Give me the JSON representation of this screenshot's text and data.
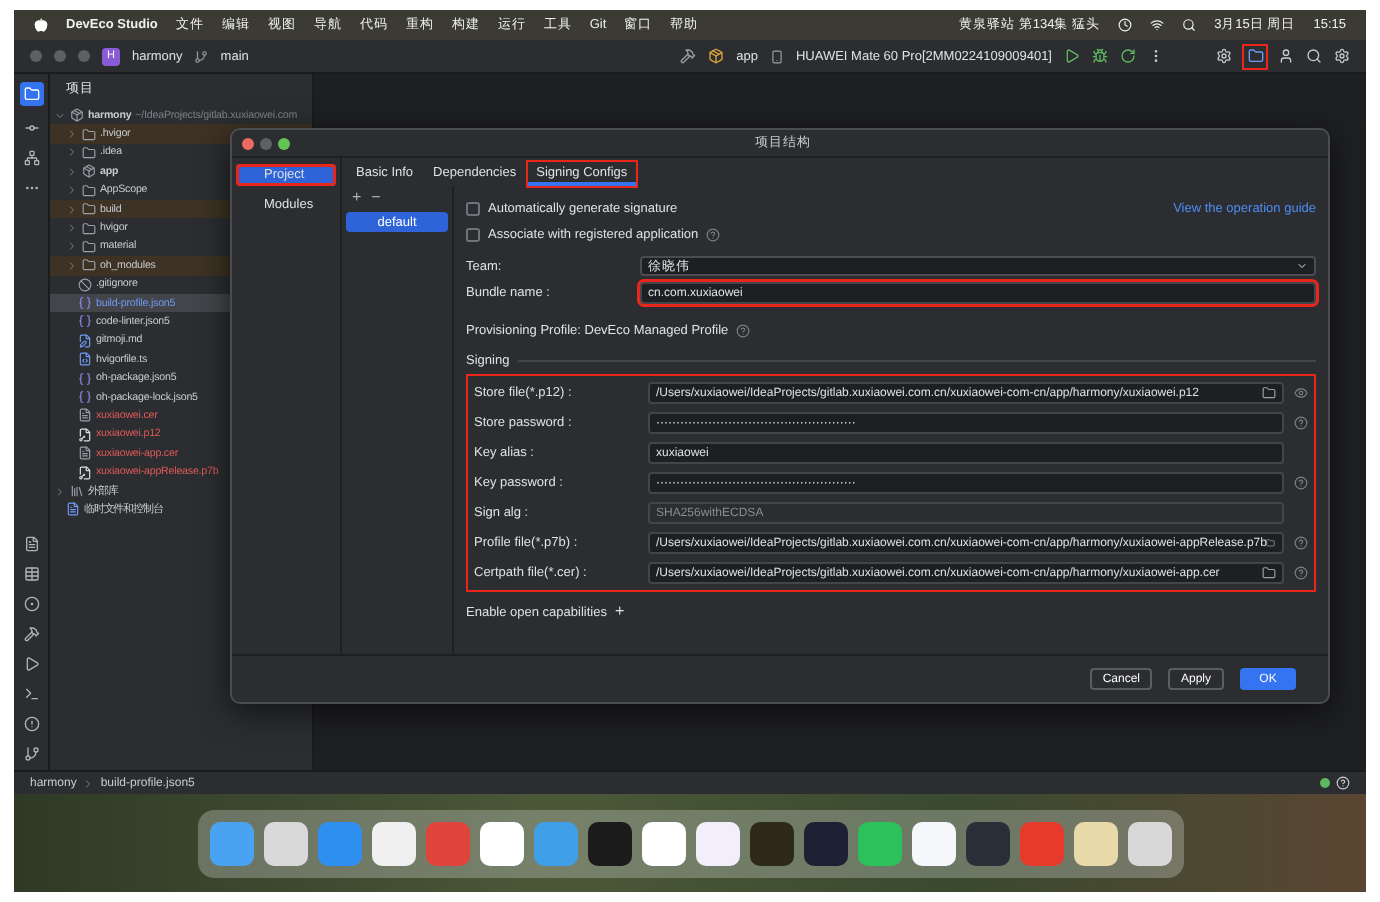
{
  "menubar": {
    "app": "DevEco Studio",
    "menus": [
      "文件",
      "编辑",
      "视图",
      "导航",
      "代码",
      "重构",
      "构建",
      "运行",
      "工具",
      "Git",
      "窗口",
      "帮助"
    ],
    "now_playing": "黄泉驿站 第134集 猛头",
    "date": "3月15日 周日",
    "time": "15:15"
  },
  "toolbar": {
    "project_badge": "H",
    "project": "harmony",
    "branch": "main",
    "module": "app",
    "device": "HUAWEI Mate 60 Pro[2MM0224109009401]",
    "folder_button_annotated": true
  },
  "project_panel": {
    "title": "项目",
    "tree": [
      {
        "name": "harmony",
        "path": "~/IdeaProjects/gitlab.xuxiaowei.com",
        "kind": "module",
        "excluded": false,
        "untracked": false,
        "selected": false,
        "expanded": true,
        "children": [
          {
            "name": ".hvigor",
            "kind": "folder",
            "excluded": true,
            "untracked": false,
            "selected": false,
            "expanded": false
          },
          {
            "name": ".idea",
            "kind": "folder",
            "excluded": false,
            "untracked": false,
            "selected": false,
            "expanded": false
          },
          {
            "name": "app",
            "kind": "module",
            "excluded": false,
            "untracked": false,
            "selected": false,
            "expanded": false
          },
          {
            "name": "AppScope",
            "kind": "folder",
            "excluded": false,
            "untracked": false,
            "selected": false,
            "expanded": false
          },
          {
            "name": "build",
            "kind": "folder",
            "excluded": true,
            "untracked": false,
            "selected": false,
            "expanded": false
          },
          {
            "name": "hvigor",
            "kind": "folder",
            "excluded": false,
            "untracked": false,
            "selected": false,
            "expanded": false
          },
          {
            "name": "material",
            "kind": "folder",
            "excluded": false,
            "untracked": false,
            "selected": false,
            "expanded": false
          },
          {
            "name": "oh_modules",
            "kind": "folder",
            "excluded": true,
            "untracked": false,
            "selected": false,
            "expanded": false
          },
          {
            "name": ".gitignore",
            "kind": "ignore",
            "excluded": false,
            "untracked": false,
            "selected": false
          },
          {
            "name": "build-profile.json5",
            "kind": "json",
            "excluded": false,
            "untracked": false,
            "selected": true
          },
          {
            "name": "code-linter.json5",
            "kind": "json",
            "excluded": false,
            "untracked": false,
            "selected": false
          },
          {
            "name": "gitmoji.md",
            "kind": "markdown",
            "excluded": false,
            "untracked": false,
            "selected": false
          },
          {
            "name": "hvigorfile.ts",
            "kind": "script",
            "excluded": false,
            "untracked": false,
            "selected": false
          },
          {
            "name": "oh-package.json5",
            "kind": "json",
            "excluded": false,
            "untracked": false,
            "selected": false
          },
          {
            "name": "oh-package-lock.json5",
            "kind": "json",
            "excluded": false,
            "untracked": false,
            "selected": false
          },
          {
            "name": "xuxiaowei.cer",
            "kind": "cert",
            "excluded": false,
            "untracked": true,
            "selected": false
          },
          {
            "name": "xuxiaowei.p12",
            "kind": "key",
            "excluded": false,
            "untracked": true,
            "selected": false
          },
          {
            "name": "xuxiaowei-app.cer",
            "kind": "cert",
            "excluded": false,
            "untracked": true,
            "selected": false
          },
          {
            "name": "xuxiaowei-appRelease.p7b",
            "kind": "key",
            "excluded": false,
            "untracked": true,
            "selected": false
          }
        ]
      },
      {
        "name": "外部库",
        "kind": "library",
        "excluded": false,
        "untracked": false,
        "selected": false,
        "expanded": false
      },
      {
        "name": "临时文件和控制台",
        "kind": "scratch",
        "excluded": false,
        "untracked": false,
        "selected": false
      }
    ]
  },
  "dialog": {
    "title": "项目结构",
    "nav": [
      {
        "label": "Project",
        "selected": true,
        "annotated": true
      },
      {
        "label": "Modules",
        "selected": false,
        "annotated": false
      }
    ],
    "tabs": [
      {
        "label": "Basic Info",
        "selected": false,
        "annotated": false
      },
      {
        "label": "Dependencies",
        "selected": false,
        "annotated": false
      },
      {
        "label": "Signing Configs",
        "selected": true,
        "annotated": true
      }
    ],
    "add": "+",
    "remove": "−",
    "configs": [
      {
        "label": "default",
        "selected": true
      }
    ],
    "options": [
      {
        "label": "Automatically generate signature",
        "checked": false
      },
      {
        "label": "Associate with registered application",
        "checked": false,
        "help": true
      }
    ],
    "guide_link": "View the operation guide",
    "team": {
      "label": "Team:",
      "value": "徐晓伟"
    },
    "bundle": {
      "label": "Bundle name :",
      "value": "cn.com.xuxiaowei",
      "annotated": true
    },
    "provisioning": "Provisioning Profile: DevEco Managed Profile",
    "signing": {
      "title": "Signing",
      "annotated": true,
      "fields": [
        {
          "label": "Store file(*.p12) :",
          "kind": "file",
          "value": "/Users/xuxiaowei/IdeaProjects/gitlab.xuxiaowei.com.cn/xuxiaowei-com-cn/app/harmony/xuxiaowei.p12",
          "reveal": true
        },
        {
          "label": "Store password :",
          "kind": "password",
          "value": "··················································",
          "help": true
        },
        {
          "label": "Key alias :",
          "kind": "text",
          "value": "xuxiaowei"
        },
        {
          "label": "Key password :",
          "kind": "password",
          "value": "··················································",
          "help": true
        },
        {
          "label": "Sign alg :",
          "kind": "readonly",
          "value": "SHA256withECDSA"
        },
        {
          "label": "Profile file(*.p7b) :",
          "kind": "file",
          "value": "/Users/xuxiaowei/IdeaProjects/gitlab.xuxiaowei.com.cn/xuxiaowei-com-cn/app/harmony/xuxiaowei-appRelease.p7b",
          "help": true
        },
        {
          "label": "Certpath file(*.cer) :",
          "kind": "file",
          "value": "/Users/xuxiaowei/IdeaProjects/gitlab.xuxiaowei.com.cn/xuxiaowei-com-cn/app/harmony/xuxiaowei-app.cer",
          "help": true
        }
      ]
    },
    "capabilities": "Enable open capabilities",
    "capabilities_add": "+",
    "buttons": [
      {
        "label": "Cancel",
        "primary": false
      },
      {
        "label": "Apply",
        "primary": false
      },
      {
        "label": "OK",
        "primary": true
      }
    ]
  },
  "status_bar": {
    "breadcrumb": [
      "harmony",
      "build-profile.json5"
    ]
  }
}
